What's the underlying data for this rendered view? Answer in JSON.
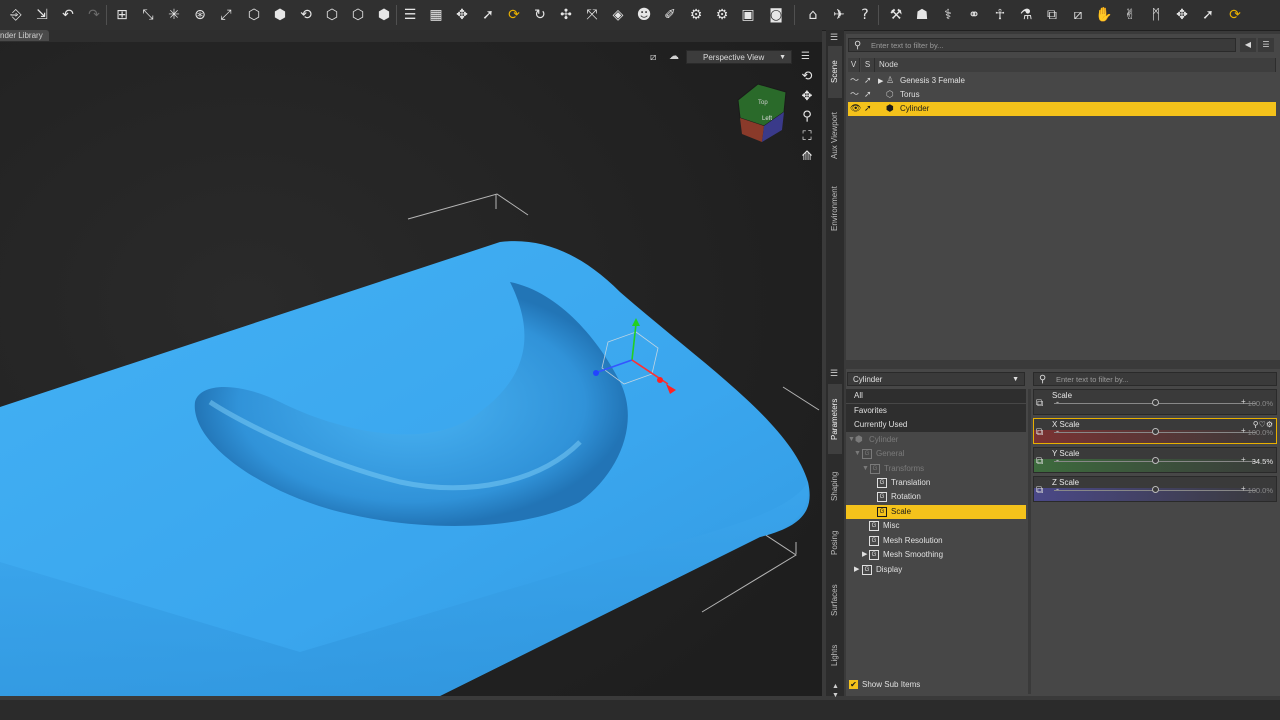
{
  "toolbar": {
    "icons": [
      "new-scene-icon",
      "open-icon",
      "undo-icon",
      "redo-icon",
      "node-select-icon",
      "joint-editor-icon",
      "geometry-editor-icon",
      "region-nav-icon",
      "active-pose-icon",
      "transform-icon",
      "tweak-icon",
      "node-align-icon",
      "translate-icon",
      "rotate-icon",
      "scale-icon",
      "node-weight-icon",
      "rigging-icon",
      "align-icon",
      "grid-icon",
      "universal-tool-icon",
      "select-icon",
      "spot-render-icon",
      "orbit-icon",
      "move-icon",
      "zoom-icon",
      "render-settings-icon",
      "render-icon",
      "camera-icon",
      "home-icon",
      "help-icon",
      "question-icon"
    ]
  },
  "tabs": {
    "library_label": "nder Library"
  },
  "viewport": {
    "view_label": "Perspective View",
    "accent": "#3aa6ee"
  },
  "left_strip": {
    "scene": "Scene",
    "aux": "Aux Viewport",
    "environment": "Environment"
  },
  "scene": {
    "filter_placeholder": "Enter text to filter by...",
    "col_v": "V",
    "col_s": "S",
    "col_node": "Node",
    "nodes": [
      {
        "label": "Genesis 3 Female",
        "selected": false
      },
      {
        "label": "Torus",
        "selected": false
      },
      {
        "label": "Cylinder",
        "selected": true
      }
    ]
  },
  "param_tabs": {
    "parameters": "Parameters",
    "shaping": "Shaping",
    "posing": "Posing",
    "surfaces": "Surfaces",
    "lights": "Lights"
  },
  "parameters": {
    "selected_node": "Cylinder",
    "filter_placeholder": "Enter text to filter by...",
    "categories": [
      "All",
      "Favorites",
      "Currently Used"
    ],
    "tree": {
      "cylinder": "Cylinder",
      "general": "General",
      "transforms": "Transforms",
      "translation": "Translation",
      "rotation": "Rotation",
      "scale": "Scale",
      "misc": "Misc",
      "mesh_resolution": "Mesh Resolution",
      "mesh_smoothing": "Mesh Smoothing",
      "display": "Display"
    },
    "g_glyph": "G",
    "sliders": [
      {
        "label": "Scale",
        "value": "100.0%",
        "fraction": 0.5,
        "tint": "#3a3a3a",
        "dim": true
      },
      {
        "label": "X Scale",
        "value": "100.0%",
        "fraction": 0.5,
        "tint": "#7a3232",
        "dim": true
      },
      {
        "label": "Y Scale",
        "value": "34.5%",
        "fraction": 0.5,
        "tint": "#3d6b3d",
        "dim": false
      },
      {
        "label": "Z Scale",
        "value": "100.0%",
        "fraction": 0.5,
        "tint": "#4a4888",
        "dim": true
      }
    ],
    "show_sub_items": "Show Sub Items"
  }
}
